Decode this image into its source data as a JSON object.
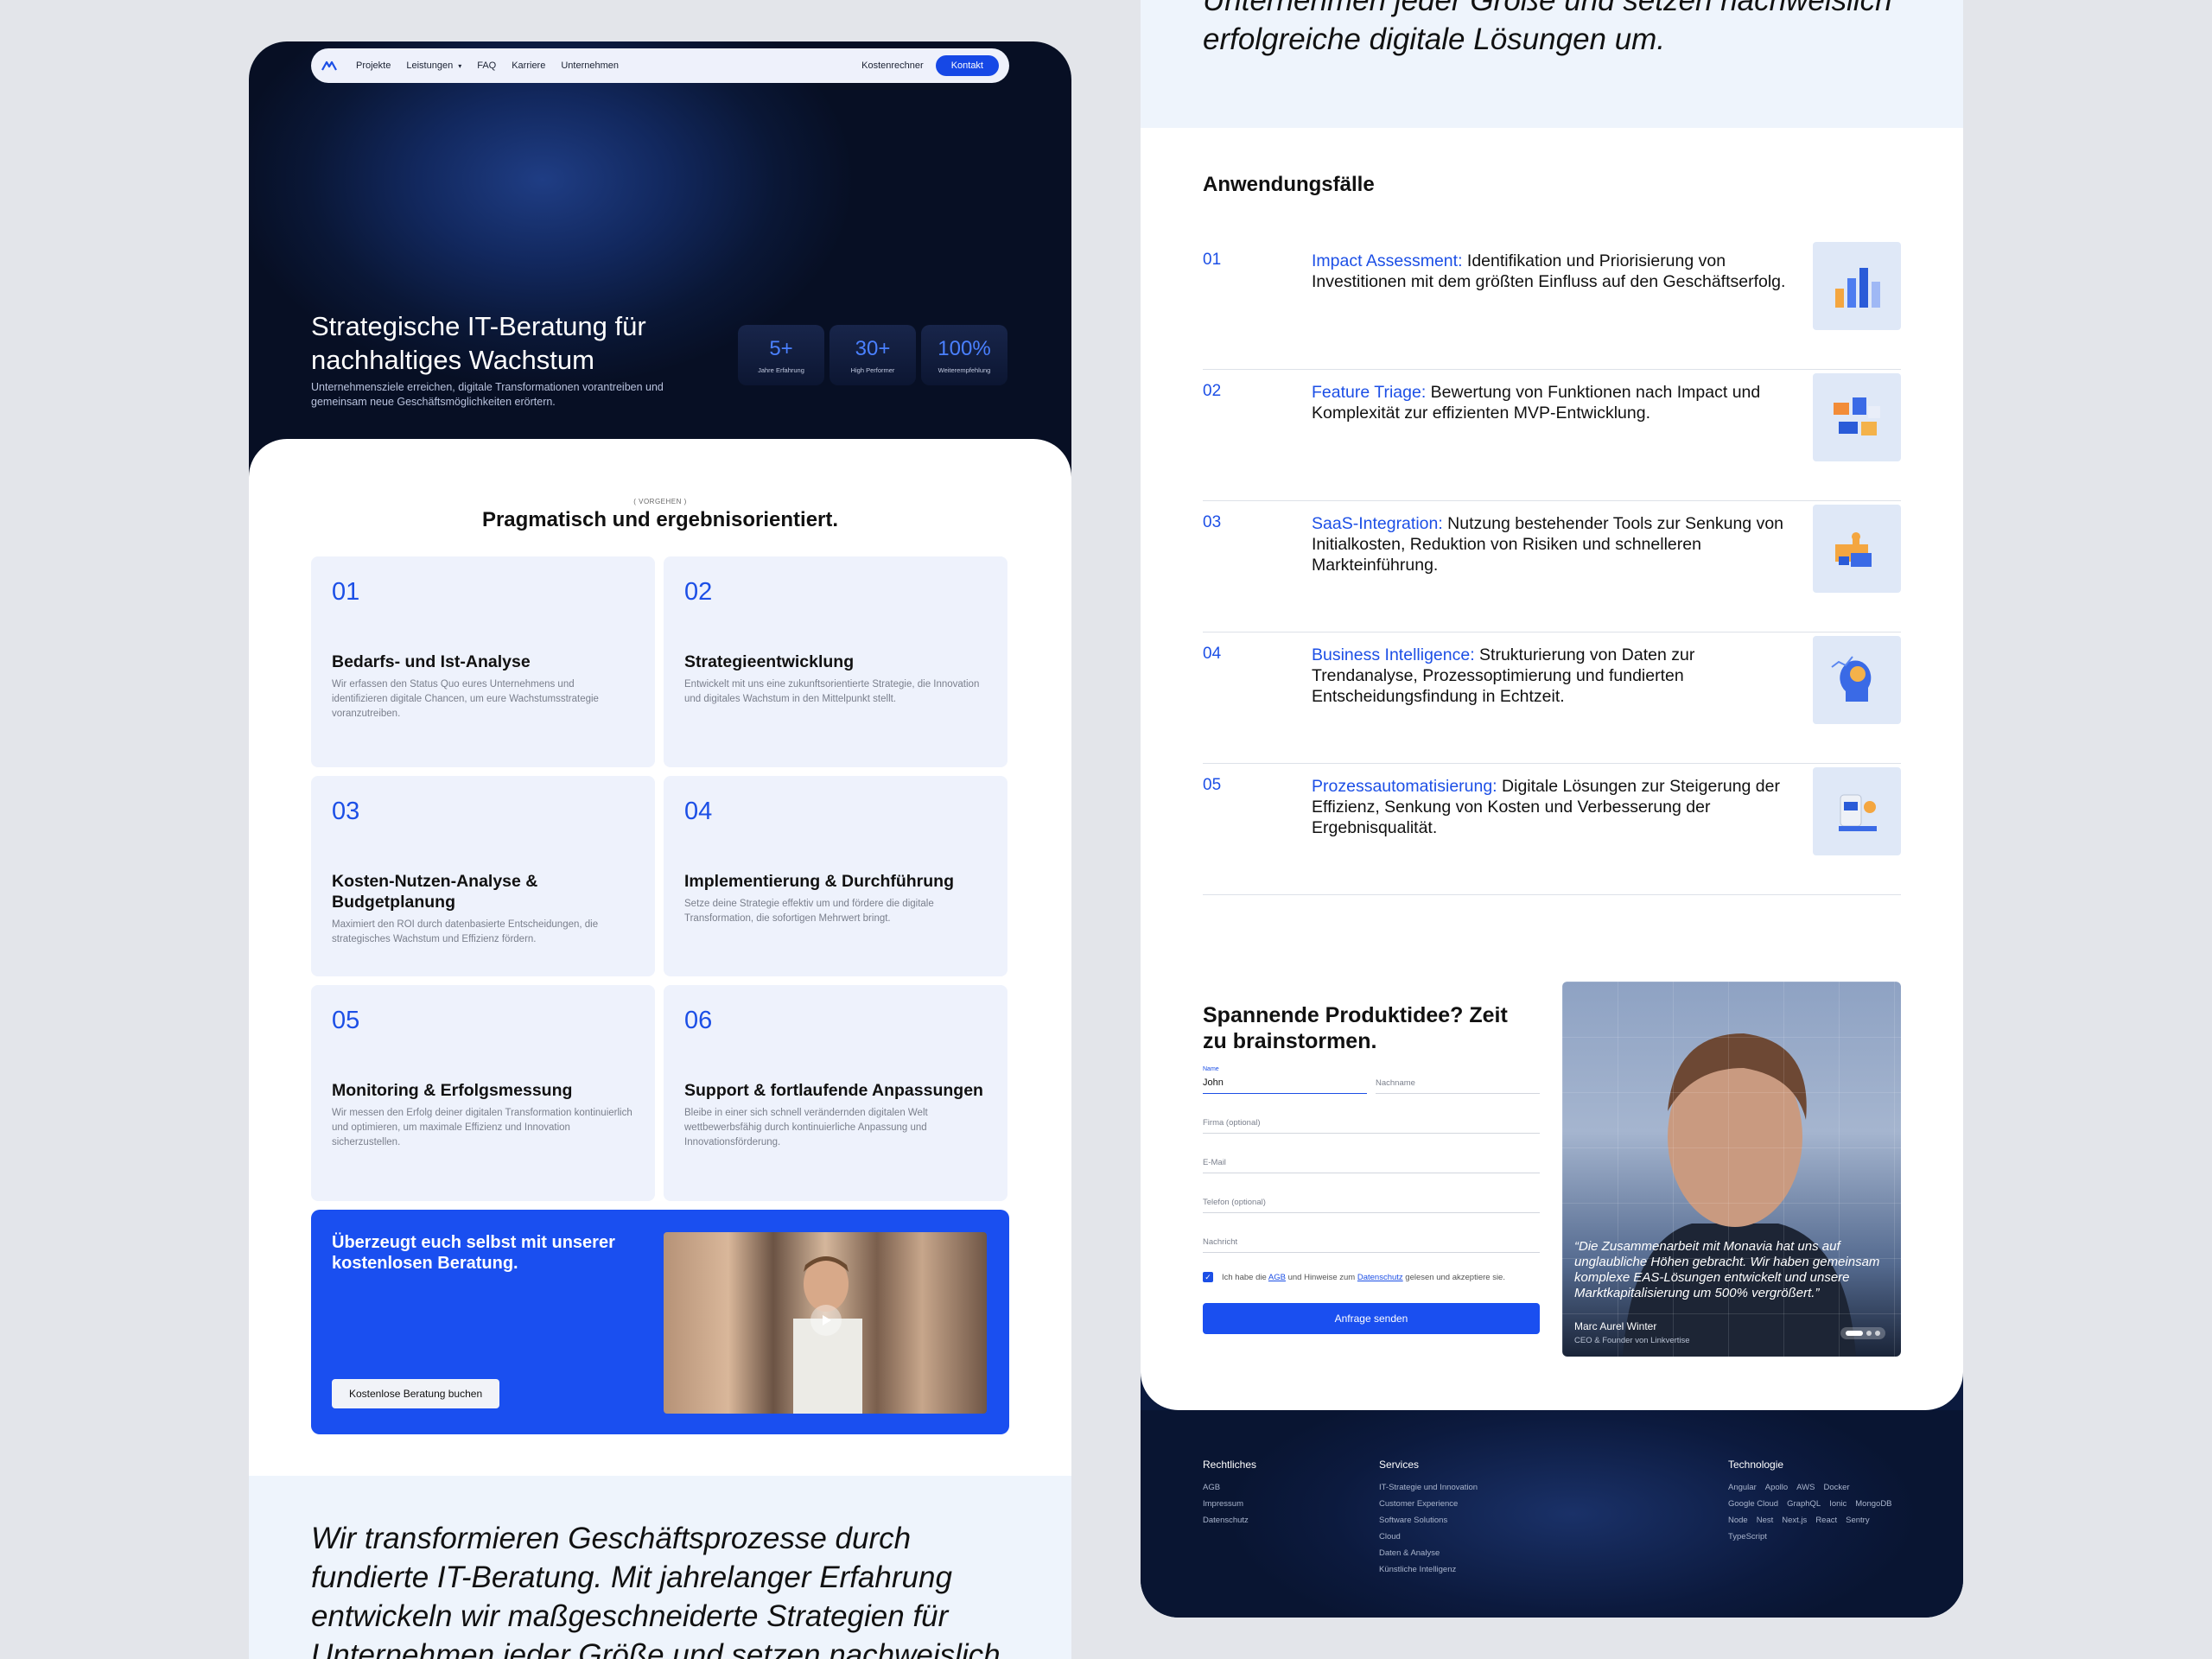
{
  "nav": {
    "items": [
      "Projekte",
      "Leistungen",
      "FAQ",
      "Karriere",
      "Unternehmen"
    ],
    "calculator": "Kostenrechner",
    "contact": "Kontakt"
  },
  "hero": {
    "title": "Strategische IT-Beratung für nachhaltiges Wachstum",
    "subtitle": "Unternehmensziele erreichen, digitale Transformationen vorantreiben und gemeinsam neue Geschäftsmöglichkeiten erörtern.",
    "stats": [
      {
        "value": "5+",
        "label": "Jahre Erfahrung"
      },
      {
        "value": "30+",
        "label": "High Performer"
      },
      {
        "value": "100%",
        "label": "Weiterempfehlung"
      }
    ]
  },
  "process": {
    "eyebrow": "( VORGEHEN )",
    "title": "Pragmatisch und ergebnisorientiert.",
    "steps": [
      {
        "num": "01",
        "title": "Bedarfs- und Ist-Analyse",
        "desc": "Wir erfassen den Status Quo eures Unternehmens und identifizieren digitale Chancen, um eure Wachstumsstrategie voranzutreiben."
      },
      {
        "num": "02",
        "title": "Strategieentwicklung",
        "desc": "Entwickelt mit uns eine zukunftsorientierte Strategie, die Innovation und digitales Wachstum in den Mittelpunkt stellt."
      },
      {
        "num": "03",
        "title": "Kosten-Nutzen-Analyse & Budgetplanung",
        "desc": "Maximiert den ROI durch datenbasierte Entscheidungen, die strategisches Wachstum und Effizienz fördern."
      },
      {
        "num": "04",
        "title": "Implementierung & Durchführung",
        "desc": "Setze deine Strategie effektiv um und fördere die digitale Transformation, die sofortigen Mehrwert bringt."
      },
      {
        "num": "05",
        "title": "Monitoring & Erfolgsmessung",
        "desc": "Wir messen den Erfolg deiner digitalen Transformation kontinuierlich und optimieren, um maximale Effizienz und Innovation sicherzustellen."
      },
      {
        "num": "06",
        "title": "Support & fortlaufende Anpassungen",
        "desc": "Bleibe in einer sich schnell verändernden digitalen Welt wettbewerbsfähig durch kontinuierliche Anpassung und Innovationsförderung."
      }
    ]
  },
  "cta": {
    "title": "Überzeugt euch selbst mit unserer kostenlosen Beratung.",
    "button": "Kostenlose Beratung buchen"
  },
  "statement": {
    "left": "Wir transformieren Geschäftsprozesse durch fundierte IT-Beratung. Mit jahrelanger Erfahrung entwickeln wir maßgeschneiderte Strategien für Unternehmen jeder Größe und setzen nachweislich",
    "right": "Unternehmen jeder Größe und setzen nachweislich erfolgreiche digitale Lösungen um."
  },
  "usecases": {
    "title": "Anwendungsfälle",
    "items": [
      {
        "num": "01",
        "key": "Impact Assessment:",
        "text": " Identifikation und Priorisierung von Investitionen mit dem größten Einfluss auf den Geschäftserfolg.",
        "icon": "bar-chart-icon"
      },
      {
        "num": "02",
        "key": "Feature Triage:",
        "text": " Bewertung von Funktionen nach Impact und Komplexität zur effizienten MVP-Entwicklung.",
        "icon": "blocks-icon"
      },
      {
        "num": "03",
        "key": "SaaS-Integration:",
        "text": " Nutzung bestehender Tools zur Senkung von Initialkosten, Reduktion von Risiken und schnelleren Markteinführung.",
        "icon": "puzzle-icon"
      },
      {
        "num": "04",
        "key": "Business Intelligence:",
        "text": " Strukturierung von Daten zur Trendanalyse, Prozessoptimierung und fundierten Entscheidungsfindung in Echtzeit.",
        "icon": "head-brain-icon"
      },
      {
        "num": "05",
        "key": "Prozessautomatisierung:",
        "text": " Digitale Lösungen zur Steigerung der Effizienz, Senkung von Kosten und Verbesserung der Ergebnisqualität.",
        "icon": "robot-icon"
      }
    ]
  },
  "form": {
    "title": "Spannende Produktidee? Zeit zu brainstormen.",
    "name_label": "Name",
    "name_value": "John",
    "lastname": "Nachname",
    "company": "Firma (optional)",
    "email": "E-Mail",
    "phone": "Telefon (optional)",
    "message": "Nachricht",
    "consent_pre": "Ich habe die ",
    "agb": "AGB",
    "consent_mid": " und Hinweise zum ",
    "privacy": "Datenschutz",
    "consent_post": " gelesen und akzeptiere sie.",
    "submit": "Anfrage senden"
  },
  "testimonial": {
    "quote": "“Die Zusammenarbeit mit Monavia hat uns auf unglaubliche Höhen gebracht. Wir haben gemeinsam komplexe EAS-Lösungen entwickelt und unsere Marktkapitalisierung um 500% vergrößert.”",
    "name": "Marc Aurel Winter",
    "role": "CEO & Founder von Linkvertise"
  },
  "footer": {
    "legal": {
      "title": "Rechtliches",
      "items": [
        "AGB",
        "Impressum",
        "Datenschutz"
      ]
    },
    "services": {
      "title": "Services",
      "items": [
        "IT-Strategie und Innovation",
        "Customer Experience",
        "Software Solutions",
        "Cloud",
        "Daten & Analyse",
        "Künstliche Intelligenz"
      ]
    },
    "tech": {
      "title": "Technologie",
      "items": [
        "Angular",
        "Apollo",
        "AWS",
        "Docker",
        "Google Cloud",
        "GraphQL",
        "Ionic",
        "MongoDB",
        "Node",
        "Nest",
        "Next.js",
        "React",
        "Sentry",
        "TypeScript"
      ]
    }
  },
  "colors": {
    "accent": "#1a4ff0",
    "hero_dark": "#0a1736",
    "card_bg": "#eef2fc"
  }
}
